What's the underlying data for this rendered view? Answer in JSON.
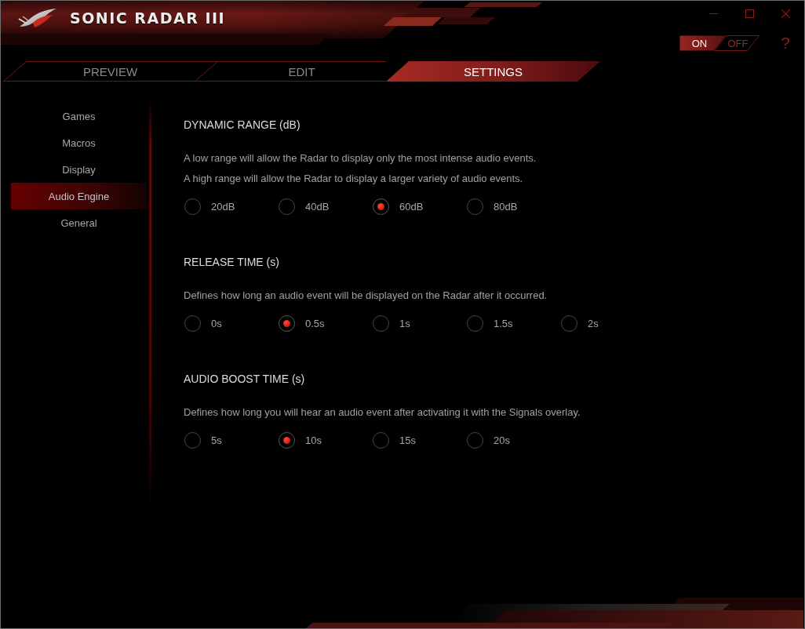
{
  "window": {
    "title": "SONIC RADAR III"
  },
  "power_toggle": [
    {
      "label": "ON",
      "selected": true
    },
    {
      "label": "OFF",
      "selected": false
    }
  ],
  "help_button": "?",
  "tabs": [
    {
      "label": "PREVIEW",
      "selected": false
    },
    {
      "label": "EDIT",
      "selected": false
    },
    {
      "label": "SETTINGS",
      "selected": true
    }
  ],
  "sidebar": {
    "items": [
      {
        "label": "Games",
        "selected": false
      },
      {
        "label": "Macros",
        "selected": false
      },
      {
        "label": "Display",
        "selected": false
      },
      {
        "label": "Audio Engine",
        "selected": true
      },
      {
        "label": "General",
        "selected": false
      }
    ]
  },
  "sections": [
    {
      "title": "DYNAMIC RANGE (dB)",
      "description": [
        "A low range will allow the Radar to display only the most intense audio events.",
        "A high range will allow the Radar to display a larger variety of audio events."
      ],
      "options": [
        {
          "label": "20dB",
          "selected": false
        },
        {
          "label": "40dB",
          "selected": false
        },
        {
          "label": "60dB",
          "selected": true
        },
        {
          "label": "80dB",
          "selected": false
        }
      ]
    },
    {
      "title": "RELEASE TIME (s)",
      "description": [
        "Defines how long an audio event will be displayed on the Radar after it occurred."
      ],
      "options": [
        {
          "label": "0s",
          "selected": false
        },
        {
          "label": "0.5s",
          "selected": true
        },
        {
          "label": "1s",
          "selected": false
        },
        {
          "label": "1.5s",
          "selected": false
        },
        {
          "label": "2s",
          "selected": false
        }
      ]
    },
    {
      "title": "AUDIO BOOST TIME (s)",
      "description": [
        "Defines how long you will hear an audio event after activating it with the Signals overlay."
      ],
      "options": [
        {
          "label": "5s",
          "selected": false
        },
        {
          "label": "10s",
          "selected": true
        },
        {
          "label": "15s",
          "selected": false
        },
        {
          "label": "20s",
          "selected": false
        }
      ]
    }
  ]
}
